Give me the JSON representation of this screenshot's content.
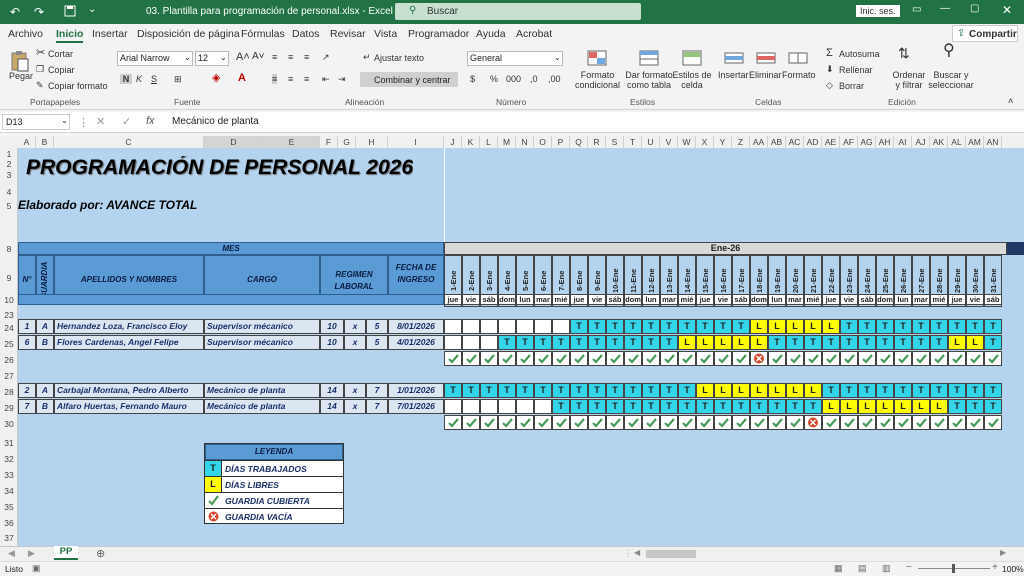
{
  "window": {
    "title": "03. Plantilla para programación de personal.xlsx  -  Excel",
    "search_placeholder": "Buscar",
    "signin": "Inic. ses."
  },
  "tabs": [
    "Archivo",
    "Inicio",
    "Insertar",
    "Disposición de página",
    "Fórmulas",
    "Datos",
    "Revisar",
    "Vista",
    "Programador",
    "Ayuda",
    "Acrobat"
  ],
  "share": "Compartir",
  "ribbon": {
    "pegar": "Pegar",
    "cortar": "Cortar",
    "copiar": "Copiar",
    "copiar_formato": "Copiar formato",
    "font_name": "Arial Narrow",
    "font_size": "12",
    "ajustar": "Ajustar texto",
    "combinar": "Combinar y centrar",
    "number_format": "General",
    "formato_condicional": "Formato condicional",
    "dar_formato": "Dar formato como tabla",
    "estilos_celda": "Estilos de celda",
    "insertar": "Insertar",
    "eliminar": "Eliminar",
    "formato": "Formato",
    "autosuma": "Autosuma",
    "rellenar": "Rellenar",
    "borrar": "Borrar",
    "ordenar": "Ordenar y filtrar",
    "buscar": "Buscar y seleccionar",
    "groups": [
      "Portapapeles",
      "Fuente",
      "Alineación",
      "Número",
      "Estilos",
      "Celdas",
      "Edición"
    ]
  },
  "formula": {
    "namebox": "D13",
    "fx": "fx",
    "value": "Mecánico de planta"
  },
  "columns": [
    "A",
    "B",
    "C",
    "D",
    "E",
    "F",
    "G",
    "H",
    "I",
    "J",
    "K",
    "L",
    "M",
    "N",
    "O",
    "P",
    "Q",
    "R",
    "S",
    "T",
    "U",
    "V",
    "W",
    "X",
    "Y",
    "Z",
    "AA",
    "AB",
    "AC",
    "AD",
    "AE",
    "AF",
    "AG",
    "AH",
    "AI",
    "AJ",
    "AK",
    "AL",
    "AM",
    "AN"
  ],
  "rows": [
    "1",
    "2",
    "3",
    "4",
    "5",
    "8",
    "9",
    "10",
    "23",
    "24",
    "25",
    "26",
    "27",
    "28",
    "29",
    "30",
    "31",
    "32",
    "33",
    "34",
    "35",
    "36",
    "37",
    "38"
  ],
  "sheet": {
    "title": "PROGRAMACIÓN DE PERSONAL 2026",
    "subtitle": "Elaborado por: AVANCE TOTAL",
    "mes_label": "MES",
    "month": "Ene-26",
    "headers": {
      "n": "N°",
      "guardia": "GUARDIA",
      "nombres": "APELLIDOS Y NOMBRES",
      "cargo": "CARGO",
      "regimen": "REGIMEN LABORAL",
      "fecha": "FECHA DE INGRESO"
    },
    "days": [
      "1-Ene",
      "2-Ene",
      "3-Ene",
      "4-Ene",
      "5-Ene",
      "6-Ene",
      "7-Ene",
      "8-Ene",
      "9-Ene",
      "10-Ene",
      "11-Ene",
      "12-Ene",
      "13-Ene",
      "14-Ene",
      "15-Ene",
      "16-Ene",
      "17-Ene",
      "18-Ene",
      "19-Ene",
      "20-Ene",
      "21-Ene",
      "22-Ene",
      "23-Ene",
      "24-Ene",
      "25-Ene",
      "26-Ene",
      "27-Ene",
      "28-Ene",
      "29-Ene",
      "30-Ene",
      "31-Ene"
    ],
    "dow": [
      "jue",
      "vie",
      "sáb",
      "dom",
      "lun",
      "mar",
      "mié",
      "jue",
      "vie",
      "sáb",
      "dom",
      "lun",
      "mar",
      "mié",
      "jue",
      "vie",
      "sáb",
      "dom",
      "lun",
      "mar",
      "mié",
      "jue",
      "vie",
      "sáb",
      "dom",
      "lun",
      "mar",
      "mié",
      "jue",
      "vie",
      "sáb"
    ],
    "employees": [
      {
        "n": "1",
        "g": "A",
        "name": "Hernandez Loza, Francisco Eloy",
        "cargo": "Supervisor mécanico",
        "r1": "10",
        "x": "x",
        "r2": "5",
        "fecha": "8/01/2026",
        "sched": [
          "",
          "",
          "",
          "",
          "",
          "",
          "",
          "T",
          "T",
          "T",
          "T",
          "T",
          "T",
          "T",
          "T",
          "T",
          "T",
          "L",
          "L",
          "L",
          "L",
          "L",
          "T",
          "T",
          "T",
          "T",
          "T",
          "T",
          "T",
          "T",
          "T"
        ]
      },
      {
        "n": "6",
        "g": "B",
        "name": "Flores Cardenas, Angel Felipe",
        "cargo": "Supervisor mécanico",
        "r1": "10",
        "x": "x",
        "r2": "5",
        "fecha": "4/01/2026",
        "sched": [
          "",
          "",
          "",
          "T",
          "T",
          "T",
          "T",
          "T",
          "T",
          "T",
          "T",
          "T",
          "T",
          "L",
          "L",
          "L",
          "L",
          "L",
          "T",
          "T",
          "T",
          "T",
          "T",
          "T",
          "T",
          "T",
          "T",
          "T",
          "L",
          "L",
          "T"
        ]
      },
      {
        "n": "2",
        "g": "A",
        "name": "Carbajal Montana, Pedro Alberto",
        "cargo": "Mecánico de planta",
        "r1": "14",
        "x": "x",
        "r2": "7",
        "fecha": "1/01/2026",
        "sched": [
          "T",
          "T",
          "T",
          "T",
          "T",
          "T",
          "T",
          "T",
          "T",
          "T",
          "T",
          "T",
          "T",
          "T",
          "L",
          "L",
          "L",
          "L",
          "L",
          "L",
          "L",
          "T",
          "T",
          "T",
          "T",
          "T",
          "T",
          "T",
          "T",
          "T",
          "T"
        ]
      },
      {
        "n": "7",
        "g": "B",
        "name": "Alfaro Huertas, Fernando Mauro",
        "cargo": "Mecánico de planta",
        "r1": "14",
        "x": "x",
        "r2": "7",
        "fecha": "7/01/2026",
        "sched": [
          "",
          "",
          "",
          "",
          "",
          "",
          "T",
          "T",
          "T",
          "T",
          "T",
          "T",
          "T",
          "T",
          "T",
          "T",
          "T",
          "T",
          "T",
          "T",
          "T",
          "L",
          "L",
          "L",
          "L",
          "L",
          "L",
          "L",
          "T",
          "T",
          "T"
        ]
      }
    ],
    "status_row1": [
      "ok",
      "ok",
      "ok",
      "ok",
      "ok",
      "ok",
      "ok",
      "ok",
      "ok",
      "ok",
      "ok",
      "ok",
      "ok",
      "ok",
      "ok",
      "ok",
      "ok",
      "x",
      "ok",
      "ok",
      "ok",
      "ok",
      "ok",
      "ok",
      "ok",
      "ok",
      "ok",
      "ok",
      "ok",
      "ok",
      "ok"
    ],
    "status_row2": [
      "ok",
      "ok",
      "ok",
      "ok",
      "ok",
      "ok",
      "ok",
      "ok",
      "ok",
      "ok",
      "ok",
      "ok",
      "ok",
      "ok",
      "ok",
      "ok",
      "ok",
      "ok",
      "ok",
      "ok",
      "x",
      "ok",
      "ok",
      "ok",
      "ok",
      "ok",
      "ok",
      "ok",
      "ok",
      "ok",
      "ok"
    ],
    "legend": {
      "title": "LEYENDA",
      "t_code": "T",
      "t": "DÍAS TRABAJADOS",
      "l_code": "L",
      "l": "DÍAS LIBRES",
      "ok": "GUARDIA CUBIERTA",
      "x": "GUARDIA VACÍA"
    },
    "colors": {
      "work": "#33d6e8",
      "free": "#ffff00",
      "header": "#5b9bd5",
      "bg": "#b4d3ee",
      "ok": "#4a9a5a",
      "bad": "#d9442c"
    }
  },
  "sheet_tab": "PP",
  "status": {
    "ready": "Listo",
    "zoom": "100%"
  }
}
